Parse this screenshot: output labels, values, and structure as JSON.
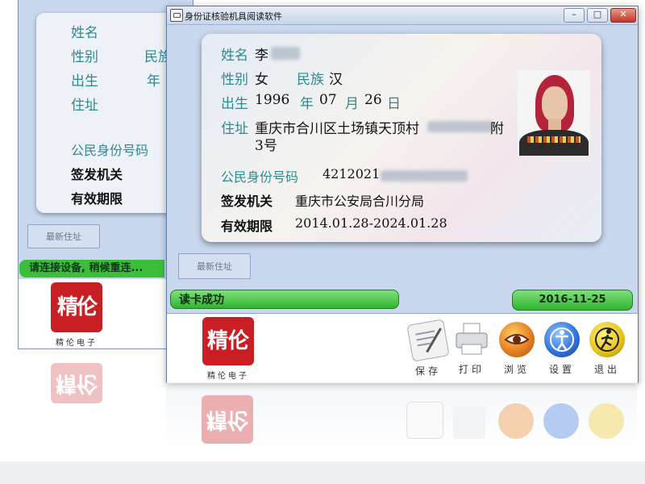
{
  "window": {
    "title": "身份证核验机具阅读软件"
  },
  "back_window": {
    "labels": {
      "name": "姓名",
      "gender": "性别",
      "ethnicity": "民族",
      "birth": "出生",
      "year": "年",
      "address": "住址",
      "id_number": "公民身份号码",
      "authority": "签发机关",
      "validity": "有效期限"
    },
    "reread_button": "最新住址",
    "status": "请连接设备, 稍候重连..."
  },
  "card": {
    "labels": {
      "name": "姓名",
      "gender": "性别",
      "ethnicity": "民族",
      "birth": "出生",
      "year_unit": "年",
      "month_unit": "月",
      "day_unit": "日",
      "address": "住址",
      "id_number": "公民身份号码",
      "authority": "签发机关",
      "validity": "有效期限"
    },
    "values": {
      "name": "李",
      "gender": "女",
      "ethnicity": "汉",
      "birth_year": "1996",
      "birth_month": "07",
      "birth_day": "26",
      "address_line1": "重庆市合川区土场镇天顶村",
      "address_line1_tail": "附",
      "address_line2": "3号",
      "id_number": "4212021",
      "authority": "重庆市公安局合川分局",
      "validity": "2014.01.28-2024.01.28"
    }
  },
  "reread_button": "最新住址",
  "status": {
    "message": "读卡成功",
    "date": "2016-11-25"
  },
  "brand": {
    "seal_chars": "精伦",
    "caption": "精伦电子"
  },
  "toolbar": [
    {
      "label": "保存",
      "icon": "save-icon"
    },
    {
      "label": "打印",
      "icon": "printer-icon"
    },
    {
      "label": "浏览",
      "icon": "eye-icon"
    },
    {
      "label": "设置",
      "icon": "settings-icon"
    },
    {
      "label": "退出",
      "icon": "exit-icon"
    }
  ],
  "colors": {
    "field_label": "#2f8a90",
    "status_green": "#2fb52f",
    "seal_red": "#c81e24",
    "window_bg": "#c9d8ee"
  }
}
